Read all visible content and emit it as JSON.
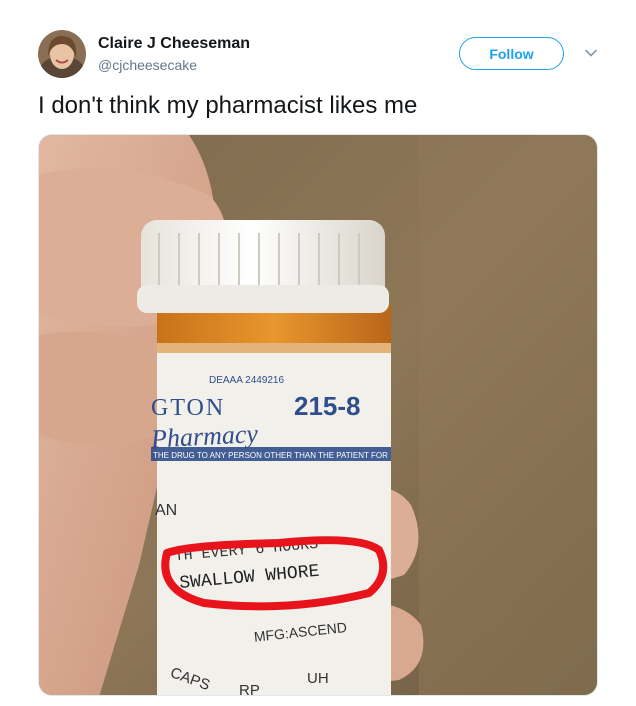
{
  "tweet": {
    "author_name": "Claire J Cheeseman",
    "author_handle": "@cjcheesecake",
    "follow_label": "Follow",
    "text": "I don't think my pharmacist likes me"
  },
  "photo": {
    "label_dea": "DEAAA 2449216",
    "label_store_partial": "GTON",
    "label_phone_partial": "215-8",
    "label_pharmacy": "Pharmacy",
    "label_warning": "THE DRUG TO ANY PERSON OTHER THAN THE PATIENT FOR",
    "label_an": "AN",
    "label_directions_top": "TH EVERY 6 HOURS",
    "label_directions": "SWALLOW WHORE",
    "label_mfg": "MFG:ASCEND",
    "label_caps": "CAPS",
    "label_rp": "RP",
    "label_uh": "UH",
    "colors": {
      "accent": "#1da1f2",
      "highlight": "#e8141c",
      "pill_bottle": "#e08a1e"
    }
  }
}
